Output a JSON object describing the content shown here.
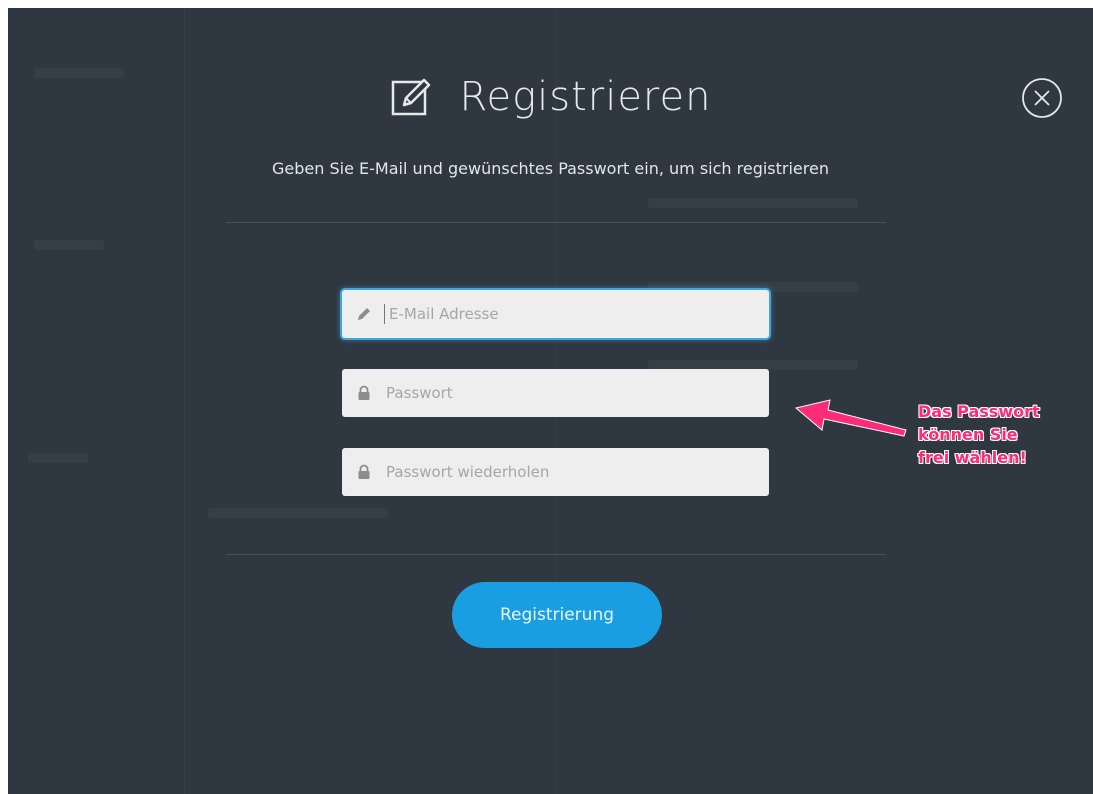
{
  "dialog": {
    "title": "Registrieren",
    "subtitle": "Geben Sie E-Mail und gewünschtes Passwort ein, um sich registrieren",
    "title_icon": "edit-icon",
    "close_icon": "close-circle-icon"
  },
  "form": {
    "email": {
      "placeholder": "E-Mail Adresse",
      "value": "",
      "icon": "pencil-icon"
    },
    "password": {
      "placeholder": "Passwort",
      "value": "",
      "icon": "lock-icon"
    },
    "password_repeat": {
      "placeholder": "Passwort wiederholen",
      "value": "",
      "icon": "lock-icon"
    },
    "submit_label": "Registrierung"
  },
  "annotation": {
    "lines": [
      "Das Passwort",
      "können Sie",
      "frei wählen!"
    ],
    "color": "#ff2b77"
  },
  "colors": {
    "overlay": "#2f3740",
    "accent": "#1a9ee2",
    "field_bg": "#eeeeee"
  }
}
